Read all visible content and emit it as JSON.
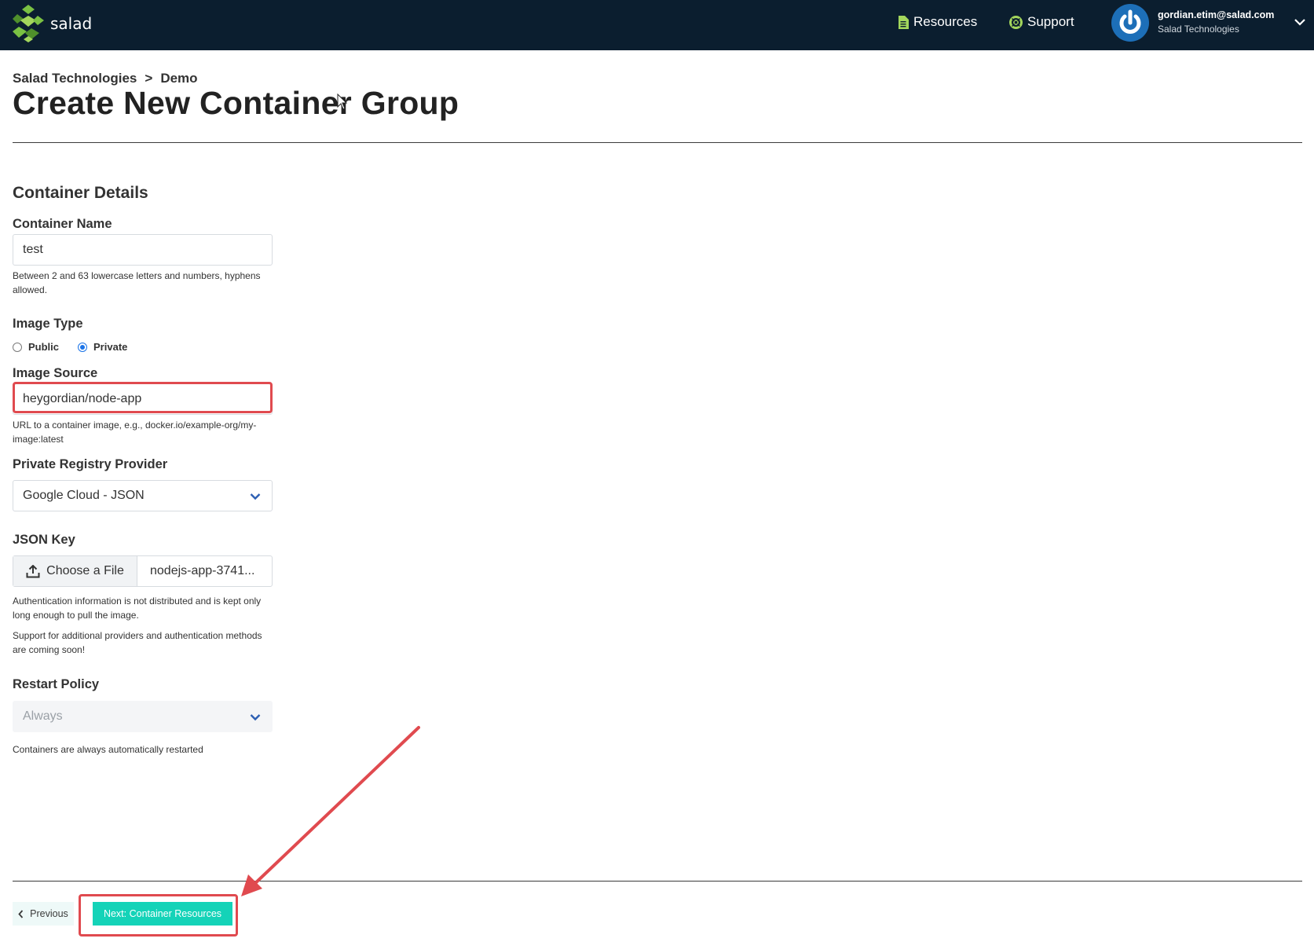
{
  "app": {
    "brand": "salad",
    "colors": {
      "nav_bg": "#0b1e2f",
      "accent": "#14d3b8",
      "highlight": "#e04a4f",
      "logo_green": "#7ac143"
    }
  },
  "nav": {
    "resources_label": "Resources",
    "resources_icon": "document-icon",
    "support_label": "Support",
    "support_icon": "lifebuoy-icon"
  },
  "user": {
    "email": "gordian.etim@salad.com",
    "org": "Salad Technologies",
    "avatar_icon": "power-icon"
  },
  "breadcrumb": {
    "org": "Salad Technologies",
    "separator": ">",
    "project": "Demo"
  },
  "page": {
    "title": "Create New Container Group"
  },
  "form": {
    "section_title": "Container Details",
    "container_name": {
      "label": "Container Name",
      "value": "test",
      "help": "Between 2 and 63 lowercase letters and numbers, hyphens allowed."
    },
    "image_type": {
      "label": "Image Type",
      "options": [
        {
          "label": "Public",
          "checked": false
        },
        {
          "label": "Private",
          "checked": true
        }
      ]
    },
    "image_source": {
      "label": "Image Source",
      "value": "heygordian/node-app",
      "help": "URL to a container image, e.g., docker.io/example-org/my-image:latest"
    },
    "registry_provider": {
      "label": "Private Registry Provider",
      "value": "Google Cloud - JSON"
    },
    "json_key": {
      "label": "JSON Key",
      "button_label": "Choose a File",
      "file_name": "nodejs-app-3741...",
      "help_1": "Authentication information is not distributed and is kept only long enough to pull the image.",
      "help_2": "Support for additional providers and authentication methods are coming soon!"
    },
    "restart_policy": {
      "label": "Restart Policy",
      "value": "Always",
      "help": "Containers are always automatically restarted"
    }
  },
  "footer": {
    "previous_label": "Previous",
    "next_label": "Next: Container Resources"
  }
}
